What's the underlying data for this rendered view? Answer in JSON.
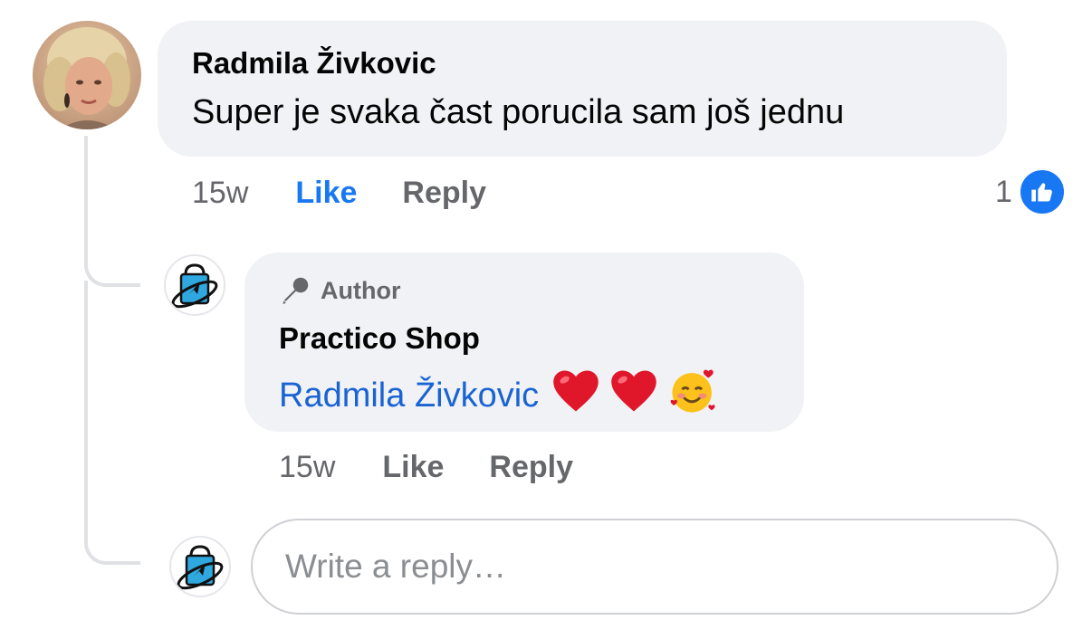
{
  "comment": {
    "author": "Radmila Živkovic",
    "text": "Super je svaka čast porucila sam još jednu",
    "time": "15w",
    "like_label": "Like",
    "reply_label": "Reply",
    "reaction_count": "1",
    "reaction_icon": "thumbs-up-icon"
  },
  "reply": {
    "badge_icon": "microphone-icon",
    "badge_label": "Author",
    "author": "Practico Shop",
    "mention": "Radmila Živkovic",
    "emojis": [
      "red-heart-icon",
      "red-heart-icon",
      "smiling-face-with-hearts-icon"
    ],
    "time": "15w",
    "like_label": "Like",
    "reply_label": "Reply"
  },
  "reply_box": {
    "placeholder": "Write a reply…"
  },
  "colors": {
    "bubble": "#f0f2f5",
    "link_blue": "#1877f2",
    "mention_blue": "#1a63d3",
    "muted_text": "#65676b",
    "primary_text": "#050505",
    "thread_line": "#dfe1e5"
  }
}
